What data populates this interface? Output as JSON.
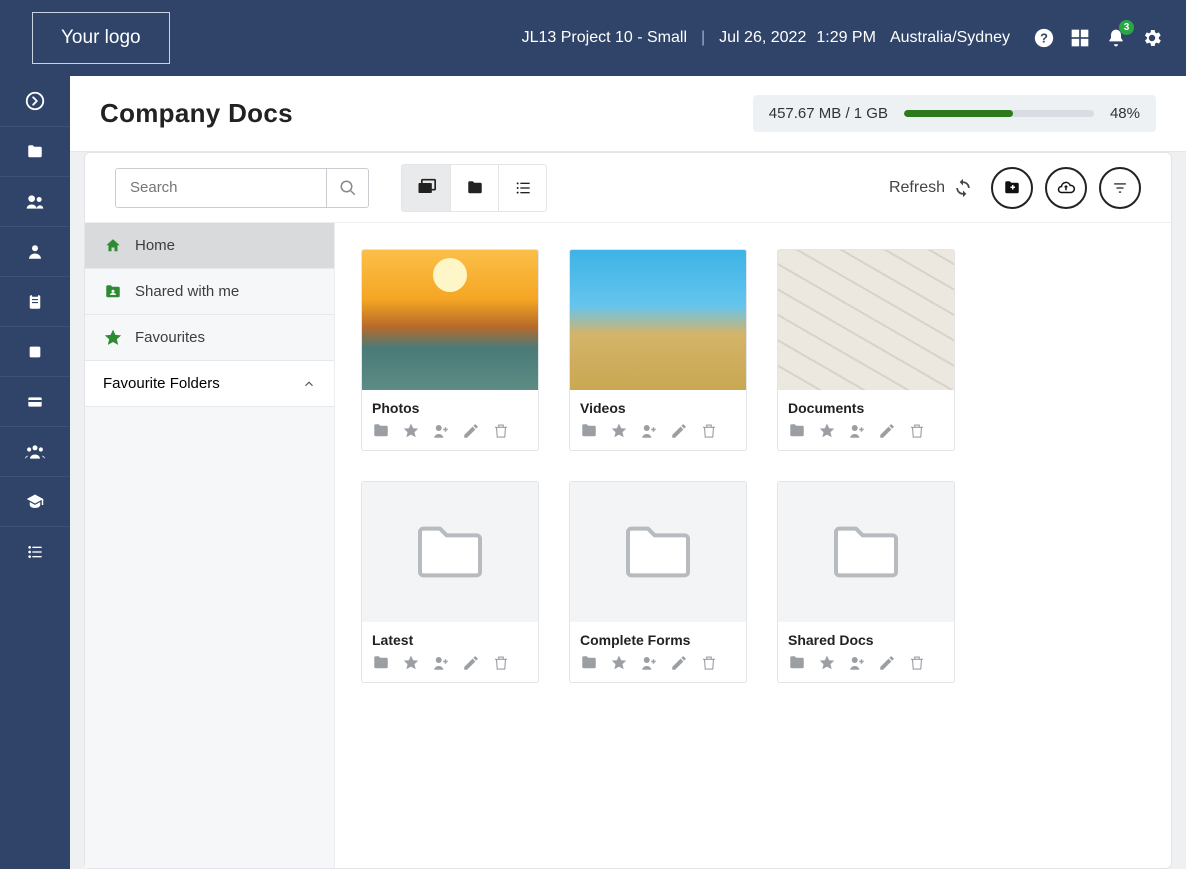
{
  "header": {
    "logo_text": "Your logo",
    "project": "JL13 Project 10 - Small",
    "date": "Jul 26, 2022",
    "time": "1:29 PM",
    "timezone": "Australia/Sydney",
    "notif_count": "3"
  },
  "page": {
    "title": "Company Docs",
    "storage_text": "457.67 MB / 1 GB",
    "storage_pct": "48%",
    "storage_pct_num": 48
  },
  "toolbar": {
    "search_placeholder": "Search",
    "refresh_label": "Refresh"
  },
  "sidepane": {
    "items": [
      {
        "label": "Home",
        "icon": "home"
      },
      {
        "label": "Shared with me",
        "icon": "shared"
      },
      {
        "label": "Favourites",
        "icon": "star"
      }
    ],
    "section_label": "Favourite Folders"
  },
  "folders": [
    {
      "name": "Photos",
      "thumb": "photos"
    },
    {
      "name": "Videos",
      "thumb": "videos"
    },
    {
      "name": "Documents",
      "thumb": "docs"
    },
    {
      "name": "Latest",
      "thumb": "folder"
    },
    {
      "name": "Complete Forms",
      "thumb": "folder"
    },
    {
      "name": "Shared Docs",
      "thumb": "folder"
    }
  ]
}
